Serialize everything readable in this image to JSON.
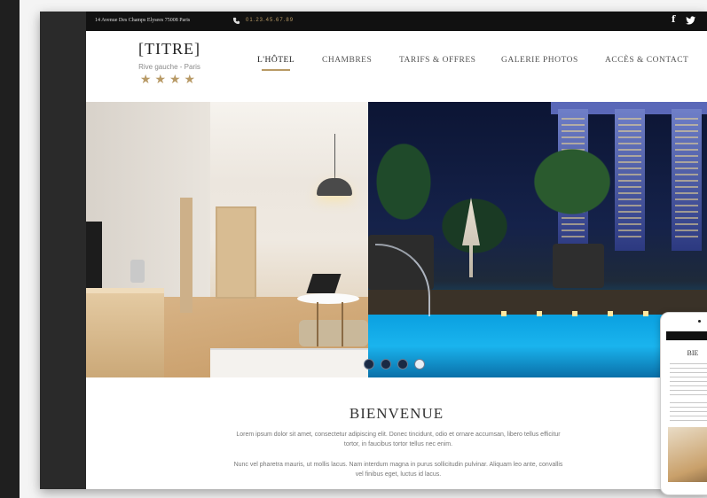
{
  "topbar": {
    "address": "14 Avenue Des Champs Elysees 75008 Paris",
    "phone": "01.23.45.67.89",
    "social": {
      "facebook": "f",
      "twitter": "twitter-icon"
    }
  },
  "brand": {
    "title": "[TITRE]",
    "subtitle": "Rive gauche - Paris",
    "stars": "★★★★"
  },
  "nav": {
    "items": [
      {
        "label": "L'HÔTEL",
        "active": true
      },
      {
        "label": "CHAMBRES"
      },
      {
        "label": "TARIFS & OFFRES"
      },
      {
        "label": "GALERIE PHOTOS"
      },
      {
        "label": "ACCÈS & CONTACT"
      }
    ],
    "accent_color": "#b89a66"
  },
  "slider": {
    "slide_count": 4,
    "active_slide": 4
  },
  "welcome": {
    "title": "BIENVENUE",
    "paragraph1": "Lorem ipsum dolor sit amet, consectetur adipiscing elit. Donec tincidunt, odio et ornare accumsan, libero tellus efficitur tortor, in faucibus tortor tellus nec enim.",
    "paragraph2": "Nunc vel pharetra mauris, ut mollis lacus. Nam interdum magna in purus sollicitudin pulvinar. Aliquam leo ante, convallis vel finibus eget, luctus id lacus."
  },
  "mobile_preview": {
    "title": "BIE"
  }
}
